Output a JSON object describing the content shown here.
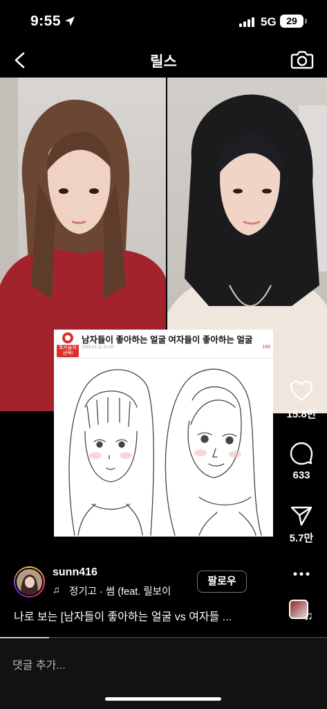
{
  "status_bar": {
    "time": "9:55",
    "network": "5G",
    "battery": "29"
  },
  "header": {
    "title": "릴스"
  },
  "post": {
    "card_title": "남자들이 좋아하는 얼굴 여자들이 좋아하는 얼굴",
    "card_badge": "톡커들의 선택!",
    "card_meta": "2023.12.11 21:03",
    "card_count": "165"
  },
  "actions": {
    "likes": "15.8만",
    "comments": "633",
    "shares": "5.7만"
  },
  "author": {
    "username": "sunn416",
    "music": "정기고 · 썸 (feat. 릴보이",
    "follow_label": "팔로우"
  },
  "caption": "나로 보는 [남자들이 좋아하는 얼굴 vs 여자들 ...",
  "comment_placeholder": "댓글 추가...",
  "playback": {
    "progress_percent": 15
  },
  "colors": {
    "background": "#000000",
    "comment_bar": "#121212",
    "badge_red": "#d9302b"
  }
}
